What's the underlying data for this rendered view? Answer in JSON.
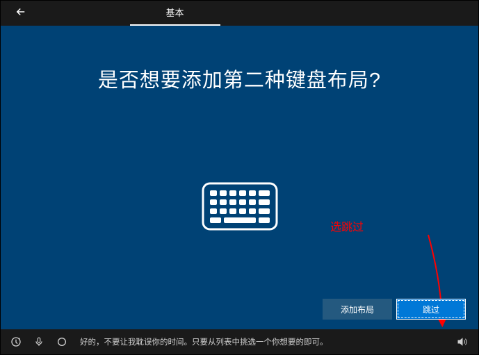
{
  "topbar": {
    "tab_label": "基本"
  },
  "main": {
    "title": "是否想要添加第二种键盘布局?",
    "annotation": "选跳过",
    "add_layout_label": "添加布局",
    "skip_label": "跳过"
  },
  "taskbar": {
    "cortana_text": "好的，不要让我耽误你的时间。只要从列表中挑选一个你想要的即可。"
  }
}
